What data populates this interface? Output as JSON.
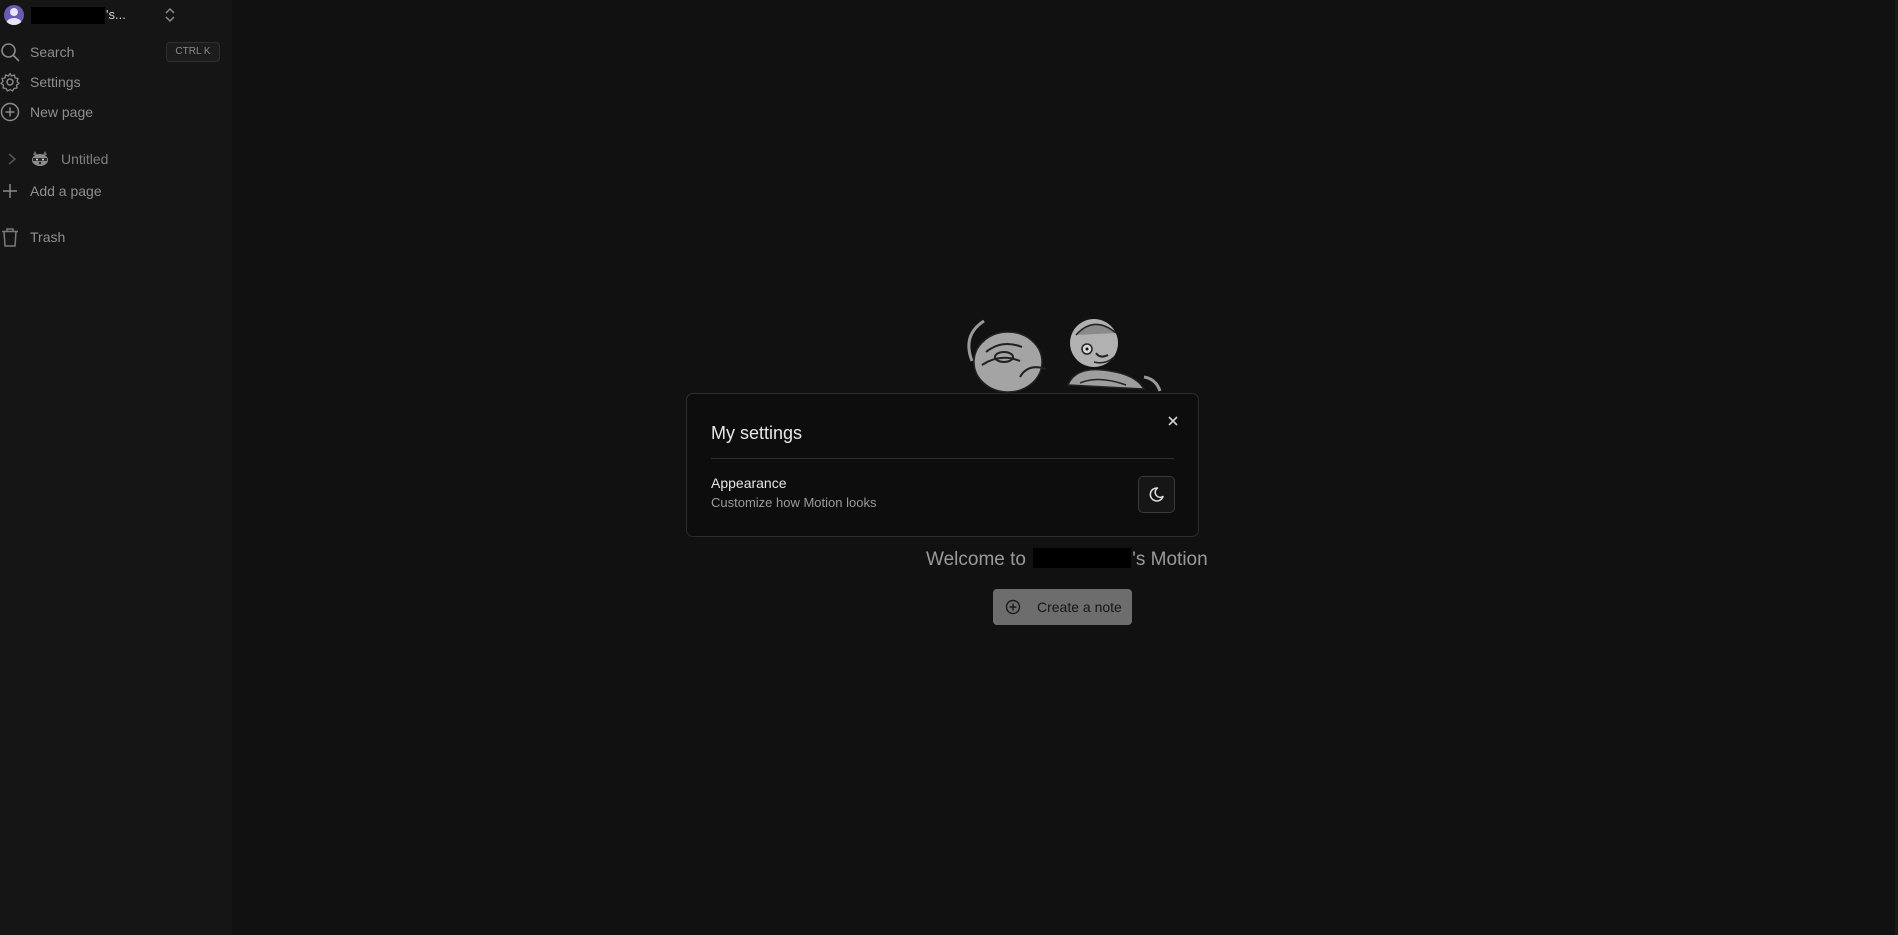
{
  "sidebar": {
    "workspace": {
      "name_suffix": "'s..."
    },
    "search": {
      "label": "Search",
      "shortcut": "CTRL K"
    },
    "settings": {
      "label": "Settings"
    },
    "new_page": {
      "label": "New page"
    },
    "pages": [
      {
        "label": "Untitled",
        "icon": "raccoon-icon"
      }
    ],
    "add_page": {
      "label": "Add a page"
    },
    "trash": {
      "label": "Trash"
    }
  },
  "main": {
    "welcome_prefix": "Welcome to",
    "welcome_suffix": "'s Motion",
    "create_note_label": "Create a note"
  },
  "modal": {
    "title": "My settings",
    "appearance_title": "Appearance",
    "appearance_desc": "Customize how Motion looks",
    "theme_icon": "moon-icon"
  },
  "colors": {
    "background": "#111111",
    "sidebar": "#151515",
    "modal": "#0d0d0d",
    "avatar": "#6b5bb5",
    "button": "#6d6d6d"
  }
}
